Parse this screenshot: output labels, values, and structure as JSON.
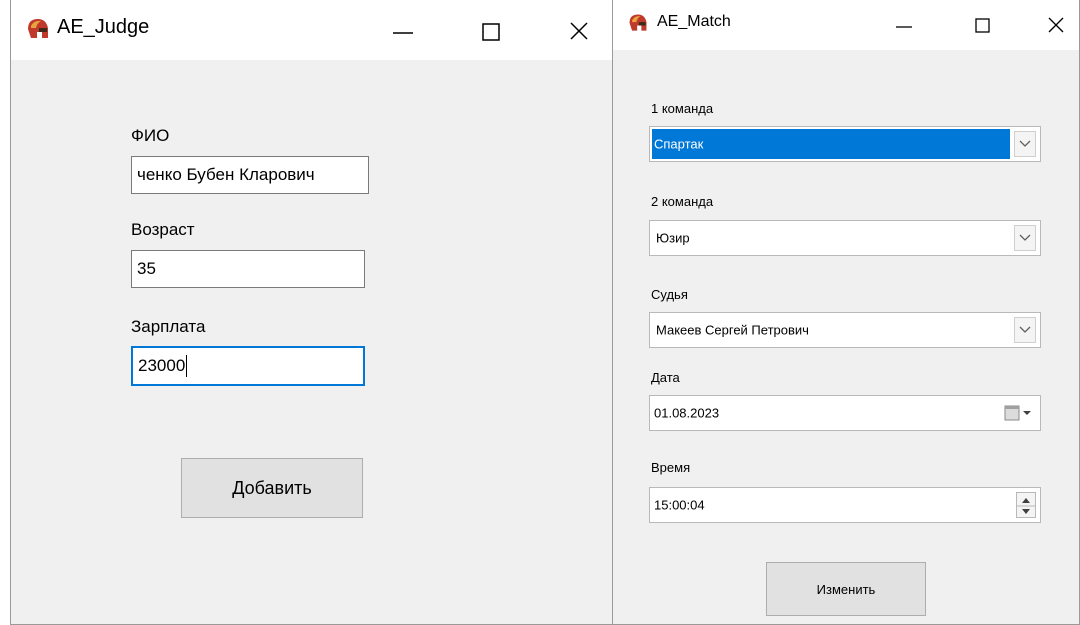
{
  "judge_window": {
    "title": "AE_Judge",
    "fio_label": "ФИО",
    "fio_value": "ченко Бубен Кларович",
    "age_label": "Возраст",
    "age_value": "35",
    "salary_label": "Зарплата",
    "salary_value": "23000",
    "add_button": "Добавить"
  },
  "match_window": {
    "title": "AE_Match",
    "team1_label": "1 команда",
    "team1_value": "Спартак",
    "team2_label": "2 команда",
    "team2_value": "Юзир",
    "judge_label": "Судья",
    "judge_value": "Макеев Сергей Петрович",
    "date_label": "Дата",
    "date_value": "01.08.2023",
    "time_label": "Время",
    "time_value": "15:00:04",
    "change_button": "Изменить"
  },
  "colors": {
    "focus_border": "#0078d7",
    "selection": "#0078d7",
    "window_bg": "#f0f0f0",
    "titlebar_bg": "#ffffff"
  },
  "icons": [
    "spartan-helmet-icon",
    "minimize-icon",
    "maximize-icon",
    "close-icon",
    "chevron-down-icon",
    "calendar-icon",
    "spin-arrows-icon"
  ]
}
